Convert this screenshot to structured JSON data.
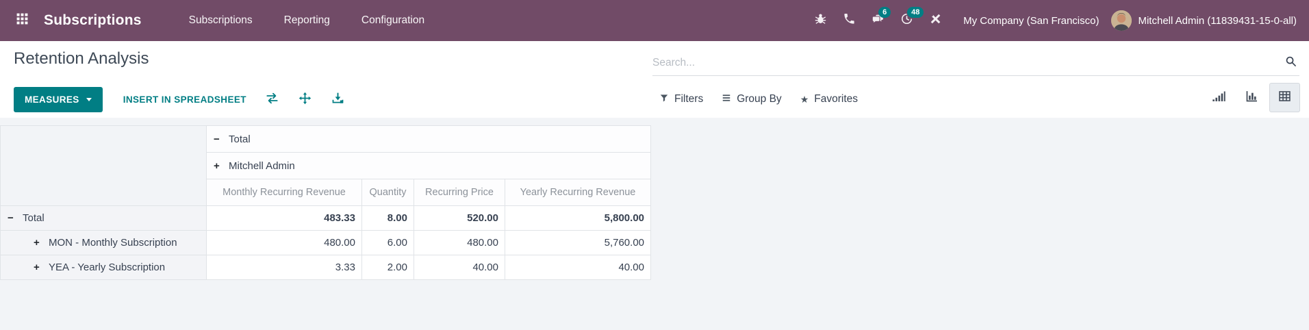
{
  "topbar": {
    "brand": "Subscriptions",
    "menu": [
      {
        "label": "Subscriptions"
      },
      {
        "label": "Reporting"
      },
      {
        "label": "Configuration"
      }
    ],
    "badges": {
      "messages": "6",
      "activities": "48"
    },
    "company": "My Company (San Francisco)",
    "user": "Mitchell Admin (11839431-15-0-all)"
  },
  "control": {
    "title": "Retention Analysis",
    "measures_label": "MEASURES",
    "insert_label": "INSERT IN SPREADSHEET",
    "search_placeholder": "Search...",
    "filters_label": "Filters",
    "group_by_label": "Group By",
    "favorites_label": "Favorites"
  },
  "icons": {
    "favorites_star": "★"
  },
  "colors": {
    "topbar": "#714B67",
    "accent": "#017E84",
    "view_bg": "#f2f4f7"
  },
  "pivot": {
    "col_total": {
      "expander": "−",
      "label": "Total"
    },
    "col_group": {
      "expander": "+",
      "label": "Mitchell Admin"
    },
    "measures": [
      "Monthly Recurring Revenue",
      "Quantity",
      "Recurring Price",
      "Yearly Recurring Revenue"
    ],
    "rows": [
      {
        "expander": "−",
        "label": "Total",
        "values": [
          "483.33",
          "8.00",
          "520.00",
          "5,800.00"
        ]
      },
      {
        "expander": "+",
        "label": "MON - Monthly Subscription",
        "values": [
          "480.00",
          "6.00",
          "480.00",
          "5,760.00"
        ]
      },
      {
        "expander": "+",
        "label": "YEA - Yearly Subscription",
        "values": [
          "3.33",
          "2.00",
          "40.00",
          "40.00"
        ]
      }
    ]
  }
}
